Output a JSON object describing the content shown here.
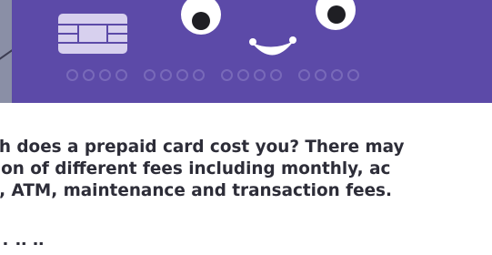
{
  "colors": {
    "card": "#5c4aa8",
    "chip": "#d7d0ee",
    "text": "#2d2d38",
    "strip": "#8a8fa6"
  },
  "illustration": {
    "icons": [
      "card-chip-icon",
      "left-eye-icon",
      "right-eye-icon",
      "smile-icon",
      "card-number-dots"
    ]
  },
  "text": {
    "line1": "ch does a prepaid card cost you? There may",
    "line2": "tion of different fees including monthly, ac",
    "line3": "g, ATM, maintenance and transaction fees.",
    "line4": "   f                  f          ll       ll"
  }
}
